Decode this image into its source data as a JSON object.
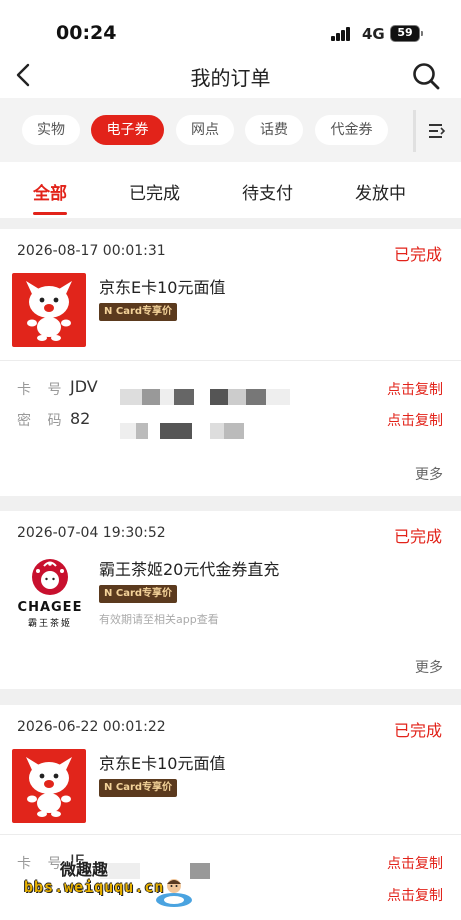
{
  "status_bar": {
    "time": "00:24",
    "network": "4G",
    "battery": "59"
  },
  "nav": {
    "title": "我的订单"
  },
  "filters": {
    "chips": [
      {
        "label": "实物",
        "active": false
      },
      {
        "label": "电子券",
        "active": true
      },
      {
        "label": "网点",
        "active": false
      },
      {
        "label": "话费",
        "active": false
      },
      {
        "label": "代金券",
        "active": false
      }
    ]
  },
  "tabs": [
    {
      "label": "全部",
      "active": true
    },
    {
      "label": "已完成",
      "active": false
    },
    {
      "label": "待支付",
      "active": false
    },
    {
      "label": "发放中",
      "active": false
    }
  ],
  "orders": [
    {
      "date": "2026-08-17 00:01:31",
      "status": "已完成",
      "product": "京东E卡10元面值",
      "badge": "N Card专享价",
      "card_label": "卡 号",
      "card_value": "JDV",
      "pwd_label": "密 码",
      "pwd_value": "82",
      "copy_label": "点击复制",
      "more_label": "更多"
    },
    {
      "date": "2026-07-04 19:30:52",
      "status": "已完成",
      "product": "霸王茶姬20元代金券直充",
      "badge": "N Card专享价",
      "note": "有效期请至相关app查看",
      "logo_text": "CHAGEE",
      "logo_sub": "霸王茶姬",
      "more_label": "更多"
    },
    {
      "date": "2026-06-22 00:01:22",
      "status": "已完成",
      "product": "京东E卡10元面值",
      "badge": "N Card专享价",
      "card_label": "卡 号",
      "card_value": "JE",
      "copy_label": "点击复制"
    }
  ],
  "watermark": {
    "title": "微趣趣",
    "url": "bbs.weiququ.cn"
  },
  "colors": {
    "accent": "#e2231a",
    "badge_bg": "#5b3a1e",
    "badge_text": "#f4d39a"
  },
  "icons": [
    "back-icon",
    "search-icon",
    "filter-menu-icon",
    "jd-mascot-icon",
    "chagee-logo-icon"
  ]
}
